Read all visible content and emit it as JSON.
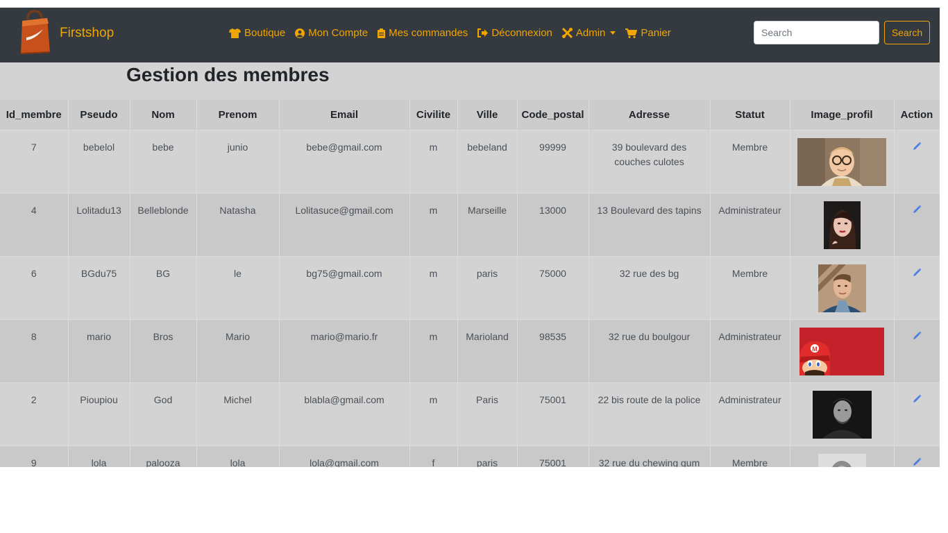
{
  "navbar": {
    "brand": "Firstshop",
    "links": [
      {
        "label": "Boutique",
        "icon": "tshirt-icon"
      },
      {
        "label": "Mon Compte",
        "icon": "user-circle-icon"
      },
      {
        "label": "Mes commandes",
        "icon": "clipboard-icon"
      },
      {
        "label": "Déconnexion",
        "icon": "sign-out-icon"
      },
      {
        "label": "Admin",
        "icon": "tools-icon"
      },
      {
        "label": "Panier",
        "icon": "cart-icon"
      }
    ],
    "search_placeholder": "Search",
    "search_button": "Search",
    "accent": "#f0a500"
  },
  "page": {
    "title": "Gestion des membres"
  },
  "table": {
    "headers": [
      "Id_membre",
      "Pseudo",
      "Nom",
      "Prenom",
      "Email",
      "Civilite",
      "Ville",
      "Code_postal",
      "Adresse",
      "Statut",
      "Image_profil",
      "Action"
    ],
    "rows": [
      {
        "id": "7",
        "pseudo": "bebelol",
        "nom": "bebe",
        "prenom": "junio",
        "email": "bebe@gmail.com",
        "civilite": "m",
        "ville": "bebeland",
        "code_postal": "99999",
        "adresse": "39 boulevard des couches culotes",
        "statut": "Membre",
        "image": "child-with-glasses-photo"
      },
      {
        "id": "4",
        "pseudo": "Lolitadu13",
        "nom": "Belleblonde",
        "prenom": "Natasha",
        "email": "Lolitasuce@gmail.com",
        "civilite": "m",
        "ville": "Marseille",
        "code_postal": "13000",
        "adresse": "13 Boulevard des tapins",
        "statut": "Administrateur",
        "image": "woman-portrait-photo"
      },
      {
        "id": "6",
        "pseudo": "BGdu75",
        "nom": "BG",
        "prenom": "le",
        "email": "bg75@gmail.com",
        "civilite": "m",
        "ville": "paris",
        "code_postal": "75000",
        "adresse": "32 rue des bg",
        "statut": "Membre",
        "image": "man-portrait-photo"
      },
      {
        "id": "8",
        "pseudo": "mario",
        "nom": "Bros",
        "prenom": "Mario",
        "email": "mario@mario.fr",
        "civilite": "m",
        "ville": "Marioland",
        "code_postal": "98535",
        "adresse": "32 rue du boulgour",
        "statut": "Administrateur",
        "image": "mario-illustration"
      },
      {
        "id": "2",
        "pseudo": "Pioupiou",
        "nom": "God",
        "prenom": "Michel",
        "email": "blabla@gmail.com",
        "civilite": "m",
        "ville": "Paris",
        "code_postal": "75001",
        "adresse": "22 bis route de la police",
        "statut": "Administrateur",
        "image": "bw-man-photo"
      },
      {
        "id": "9",
        "pseudo": "lola",
        "nom": "palooza",
        "prenom": "lola",
        "email": "lola@gmail.com",
        "civilite": "f",
        "ville": "paris",
        "code_postal": "75001",
        "adresse": "32 rue du chewing gum",
        "statut": "Membre",
        "image": "bw-portrait-photo"
      }
    ]
  }
}
